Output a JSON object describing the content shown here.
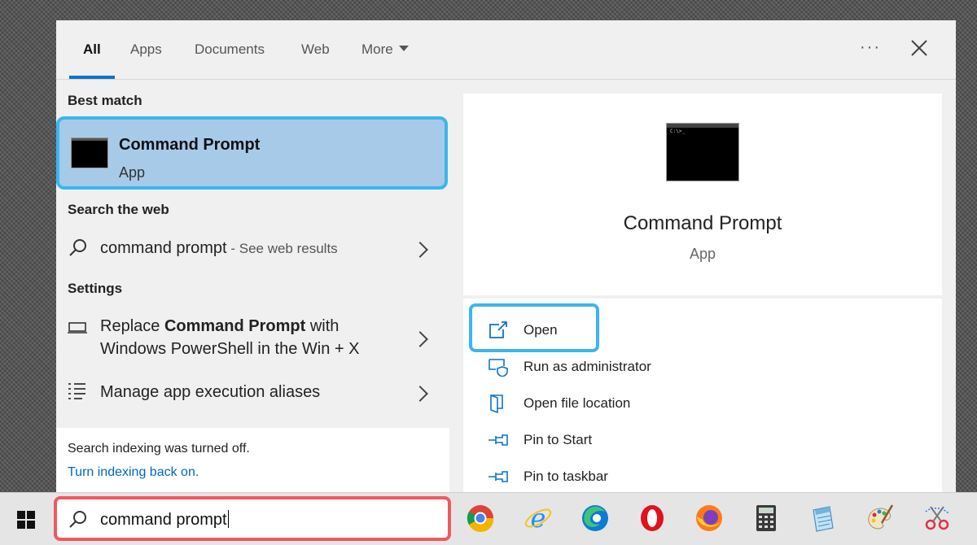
{
  "tabs": [
    {
      "label": "All",
      "active": true
    },
    {
      "label": "Apps"
    },
    {
      "label": "Documents"
    },
    {
      "label": "Web"
    },
    {
      "label": "More"
    }
  ],
  "toolbar": {
    "more_options": "···"
  },
  "left": {
    "best_match_heading": "Best match",
    "best_match": {
      "title": "Command Prompt",
      "subtitle": "App"
    },
    "web_heading": "Search the web",
    "web_result": {
      "query": "command prompt",
      "suffix": " - See web results"
    },
    "settings_heading": "Settings",
    "settings_items": [
      {
        "pre": "Replace ",
        "bold": "Command Prompt",
        "post": " with",
        "line2": "Windows PowerShell in the Win + X"
      },
      {
        "label": "Manage app execution aliases"
      }
    ],
    "footer": {
      "notice": "Search indexing was turned off.",
      "link": "Turn indexing back on."
    }
  },
  "right": {
    "title": "Command Prompt",
    "subtitle": "App",
    "icon_glyph": "C:\\>_",
    "actions": [
      {
        "label": "Open",
        "icon": "open-icon"
      },
      {
        "label": "Run as administrator",
        "icon": "shield-icon"
      },
      {
        "label": "Open file location",
        "icon": "folder-icon"
      },
      {
        "label": "Pin to Start",
        "icon": "pin-icon"
      },
      {
        "label": "Pin to taskbar",
        "icon": "pin-icon"
      }
    ]
  },
  "taskbar": {
    "search_value": "command prompt",
    "apps": [
      "chrome-icon",
      "internet-explorer-icon",
      "edge-icon",
      "opera-icon",
      "firefox-icon",
      "calculator-icon",
      "notepad-icon",
      "paint-icon",
      "snipping-tool-icon"
    ]
  },
  "colors": {
    "accent": "#0a74c9",
    "highlight": "#a8cae9",
    "highlight_border": "#3bb6ee",
    "search_border": "#ee5a60"
  }
}
